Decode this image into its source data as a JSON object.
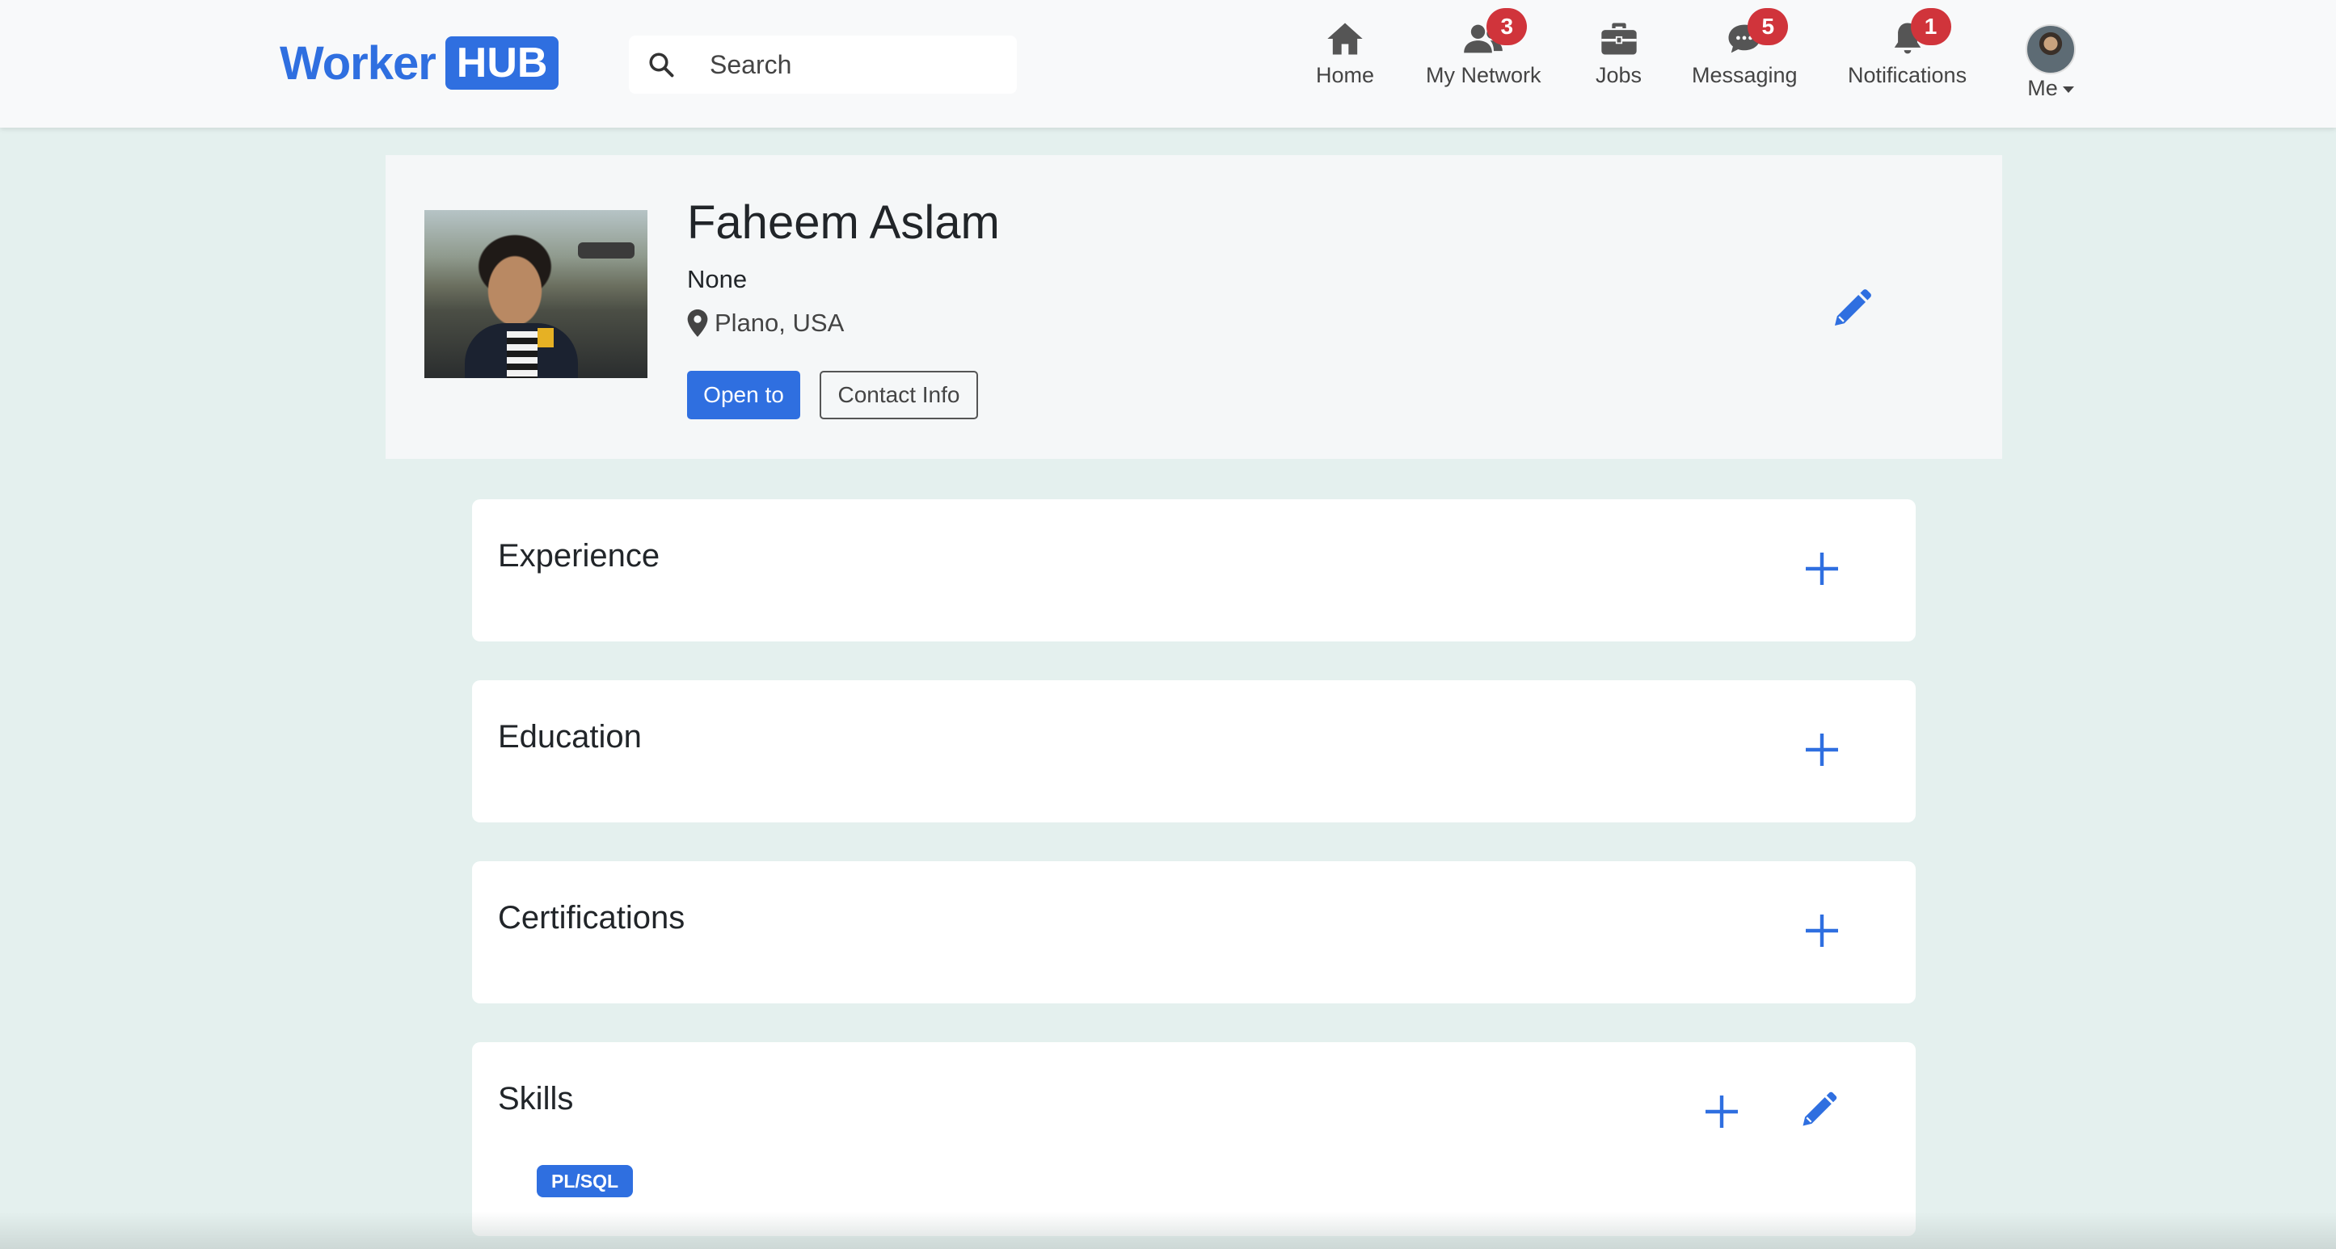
{
  "brand": {
    "name_part1": "Worker",
    "name_part2": "HUB"
  },
  "search": {
    "placeholder": "Search"
  },
  "nav": {
    "items": [
      {
        "label": "Home",
        "icon": "home-icon"
      },
      {
        "label": "My Network",
        "icon": "network-icon",
        "badge": "3"
      },
      {
        "label": "Jobs",
        "icon": "briefcase-icon"
      },
      {
        "label": "Messaging",
        "icon": "chat-icon",
        "badge": "5"
      },
      {
        "label": "Notifications",
        "icon": "bell-icon",
        "badge": "1"
      }
    ],
    "me_label": "Me"
  },
  "profile": {
    "name": "Faheem Aslam",
    "headline": "None",
    "location": "Plano, USA",
    "open_to_label": "Open to",
    "contact_info_label": "Contact Info"
  },
  "sections": {
    "experience": {
      "title": "Experience"
    },
    "education": {
      "title": "Education"
    },
    "certifications": {
      "title": "Certifications"
    },
    "skills": {
      "title": "Skills",
      "items": [
        "PL/SQL"
      ]
    }
  },
  "colors": {
    "accent": "#2f6fe0",
    "badge": "#d0343b",
    "page_bg": "#e4f0ee",
    "navbar_bg": "#f8f9fa"
  }
}
